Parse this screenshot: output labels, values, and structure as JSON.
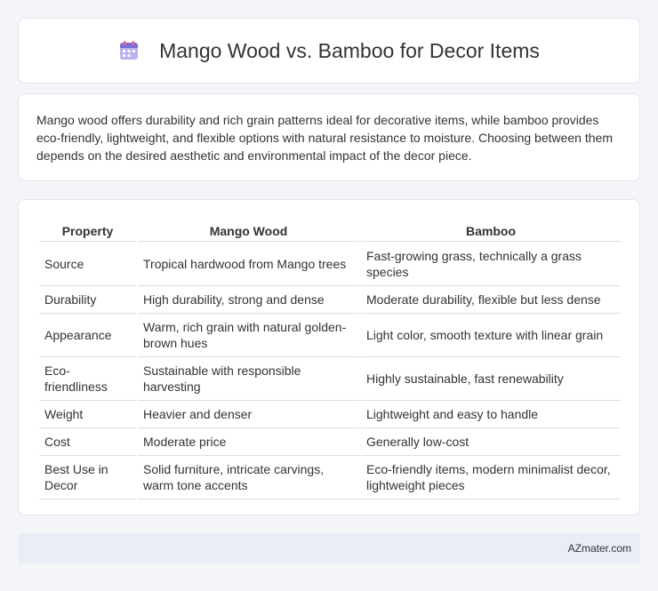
{
  "header": {
    "title": "Mango Wood vs. Bamboo for Decor Items",
    "icon": "calendar-icon"
  },
  "intro": {
    "text": "Mango wood offers durability and rich grain patterns ideal for decorative items, while bamboo provides eco-friendly, lightweight, and flexible options with natural resistance to moisture. Choosing between them depends on the desired aesthetic and environmental impact of the decor piece."
  },
  "table": {
    "headers": [
      "Property",
      "Mango Wood",
      "Bamboo"
    ],
    "rows": [
      [
        "Source",
        "Tropical hardwood from Mango trees",
        "Fast-growing grass, technically a grass species"
      ],
      [
        "Durability",
        "High durability, strong and dense",
        "Moderate durability, flexible but less dense"
      ],
      [
        "Appearance",
        "Warm, rich grain with natural golden-brown hues",
        "Light color, smooth texture with linear grain"
      ],
      [
        "Eco-friendliness",
        "Sustainable with responsible harvesting",
        "Highly sustainable, fast renewability"
      ],
      [
        "Weight",
        "Heavier and denser",
        "Lightweight and easy to handle"
      ],
      [
        "Cost",
        "Moderate price",
        "Generally low-cost"
      ],
      [
        "Best Use in Decor",
        "Solid furniture, intricate carvings, warm tone accents",
        "Eco-friendly items, modern minimalist decor, lightweight pieces"
      ]
    ]
  },
  "footer": {
    "text": "AZmater.com"
  },
  "colors": {
    "background": "#f3f5f9",
    "card": "#ffffff",
    "footer_bg": "#e8edf6",
    "icon_purple": "#8a7bd8",
    "icon_red": "#e8697a"
  }
}
